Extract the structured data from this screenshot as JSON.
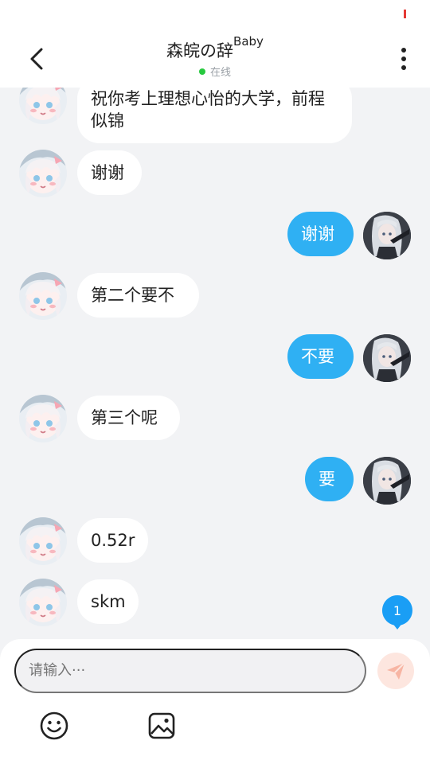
{
  "header": {
    "title": "森皖の辞",
    "title_suffix": "Baby",
    "status": "在线",
    "status_color": "#27c93f"
  },
  "colors": {
    "accent": "#2fb0f3",
    "status_mark": "#e53935"
  },
  "messages": [
    {
      "side": "left",
      "text": "祝你考上理想心怡的大学，前程似锦"
    },
    {
      "side": "left",
      "text": "谢谢"
    },
    {
      "side": "right",
      "text": "谢谢"
    },
    {
      "side": "left",
      "text": "第二个要不"
    },
    {
      "side": "right",
      "text": "不要"
    },
    {
      "side": "left",
      "text": "第三个呢"
    },
    {
      "side": "right",
      "text": "要"
    },
    {
      "side": "left",
      "text": "0.52r"
    },
    {
      "side": "left",
      "text": "skm"
    }
  ],
  "unread_badge": "1",
  "composer": {
    "placeholder": "请输入···"
  },
  "icons": {
    "back": "back-arrow-icon",
    "more": "more-vertical-icon",
    "send": "send-icon",
    "emoji": "emoji-icon",
    "image": "image-icon"
  }
}
